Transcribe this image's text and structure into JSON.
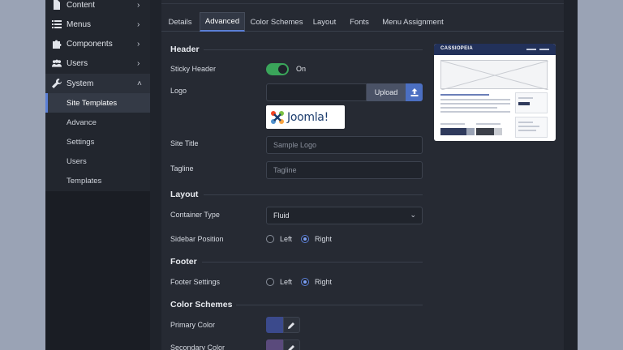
{
  "sidebar": {
    "items": [
      {
        "label": "Content",
        "icon": "file-icon"
      },
      {
        "label": "Menus",
        "icon": "list-icon"
      },
      {
        "label": "Components",
        "icon": "puzzle-icon"
      },
      {
        "label": "Users",
        "icon": "users-icon"
      },
      {
        "label": "System",
        "icon": "wrench-icon"
      }
    ],
    "sub_items": [
      "Site Templates",
      "Advance",
      "Settings",
      "Users",
      "Templates"
    ]
  },
  "tabs": [
    "Details",
    "Advanced",
    "Color Schemes",
    "Layout",
    "Fonts",
    "Menu Assignment"
  ],
  "header_section": {
    "title": "Header",
    "sticky_label": "Sticky Header",
    "sticky_state": "On",
    "logo_label": "Logo",
    "upload_label": "Upload",
    "logo_brand_text": "Joomla!",
    "site_title_label": "Site Title",
    "site_title_placeholder": "Sample Logo",
    "tagline_label": "Tagline",
    "tagline_placeholder": "Tagline"
  },
  "layout_section": {
    "title": "Layout",
    "container_label": "Container Type",
    "container_value": "Fluid",
    "sidebar_position_label": "Sidebar Position",
    "left_label": "Left",
    "right_label": "Right",
    "selected": "Right"
  },
  "footer_section": {
    "title": "Footer",
    "settings_label": "Footer Settings",
    "left_label": "Left",
    "right_label": "Right",
    "selected": "Right"
  },
  "color_section": {
    "title": "Color Schemes",
    "primary_label": "Primary Color",
    "primary_color": "#3b4a8c",
    "secondary_label": "Secondary Color",
    "secondary_color": "#5a4a7c"
  },
  "preview": {
    "title": "CASSIOPEIA"
  },
  "colors": {
    "accent": "#5b7fd6",
    "toggle_on": "#3aa55a"
  }
}
